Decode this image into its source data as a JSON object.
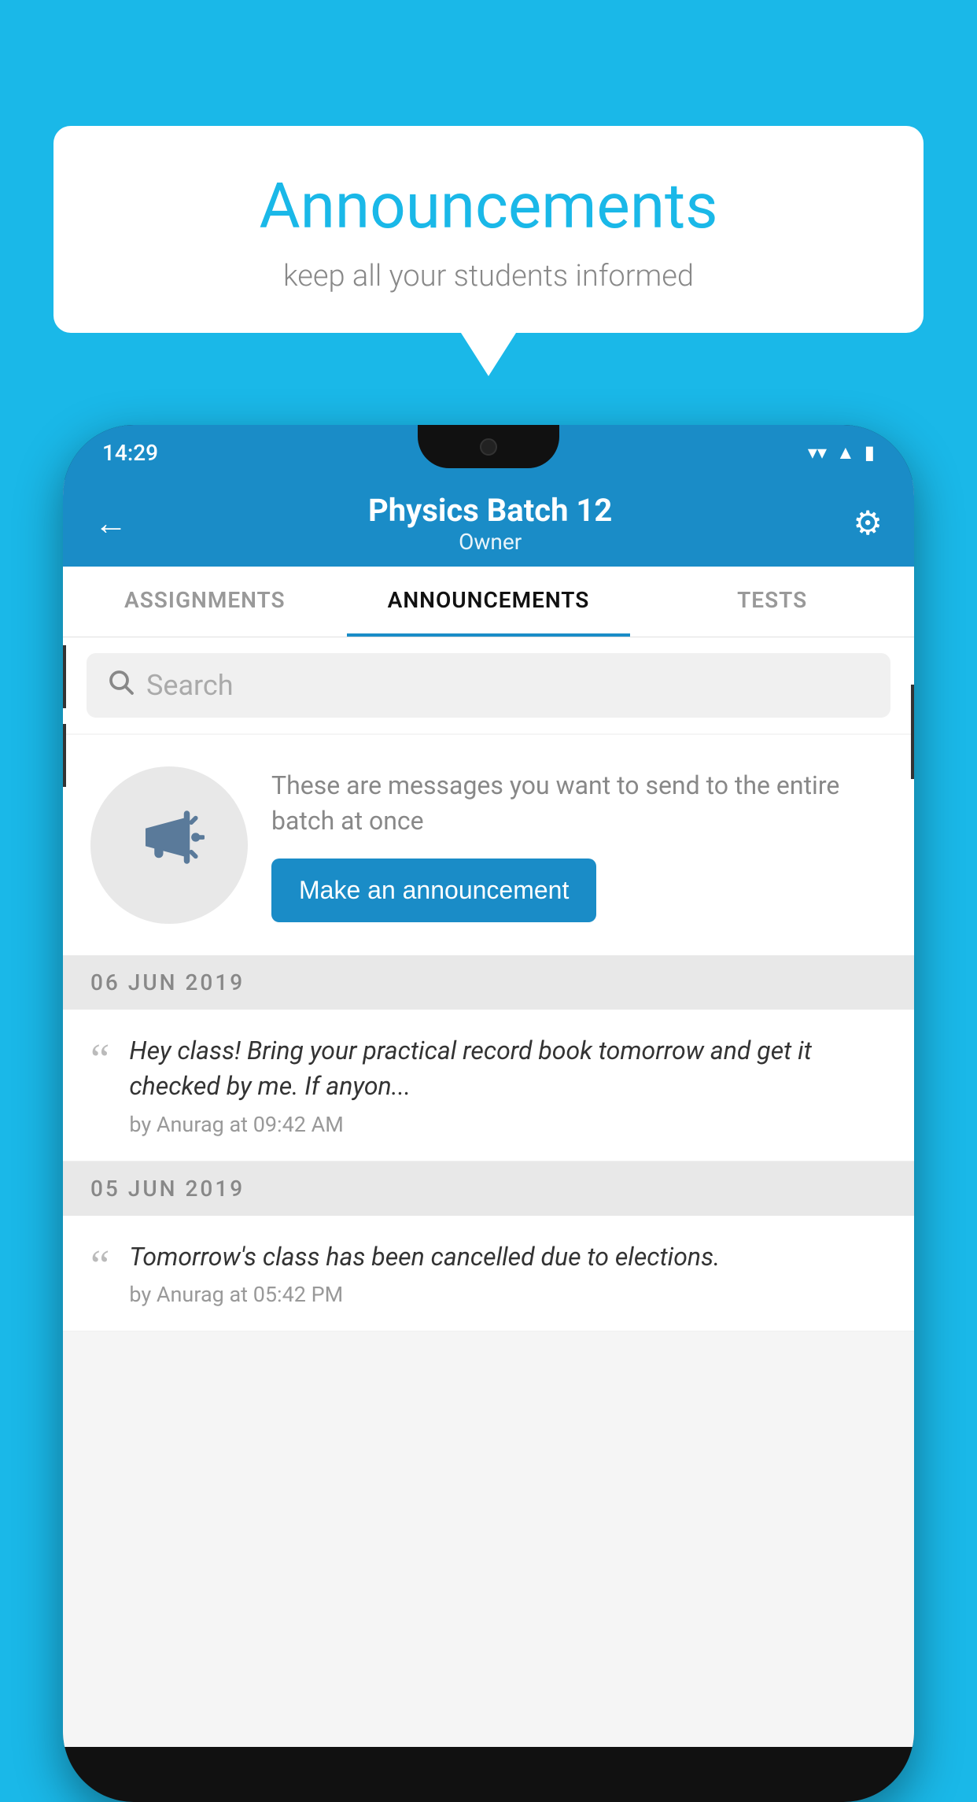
{
  "background_color": "#1ab8e8",
  "speech_bubble": {
    "title": "Announcements",
    "subtitle": "keep all your students informed"
  },
  "status_bar": {
    "time": "14:29",
    "wifi_icon": "▼",
    "signal_icon": "▲",
    "battery_icon": "▮"
  },
  "app_header": {
    "back_label": "←",
    "title": "Physics Batch 12",
    "subtitle": "Owner",
    "gear_label": "⚙"
  },
  "tabs": [
    {
      "label": "ASSIGNMENTS",
      "active": false
    },
    {
      "label": "ANNOUNCEMENTS",
      "active": true
    },
    {
      "label": "TESTS",
      "active": false
    }
  ],
  "search": {
    "placeholder": "Search"
  },
  "promo_section": {
    "description": "These are messages you want to send to the entire batch at once",
    "button_label": "Make an announcement"
  },
  "announcements": [
    {
      "date": "06  JUN  2019",
      "text": "Hey class! Bring your practical record book tomorrow and get it checked by me. If anyon...",
      "meta": "by Anurag at 09:42 AM"
    },
    {
      "date": "05  JUN  2019",
      "text": "Tomorrow's class has been cancelled due to elections.",
      "meta": "by Anurag at 05:42 PM"
    }
  ]
}
